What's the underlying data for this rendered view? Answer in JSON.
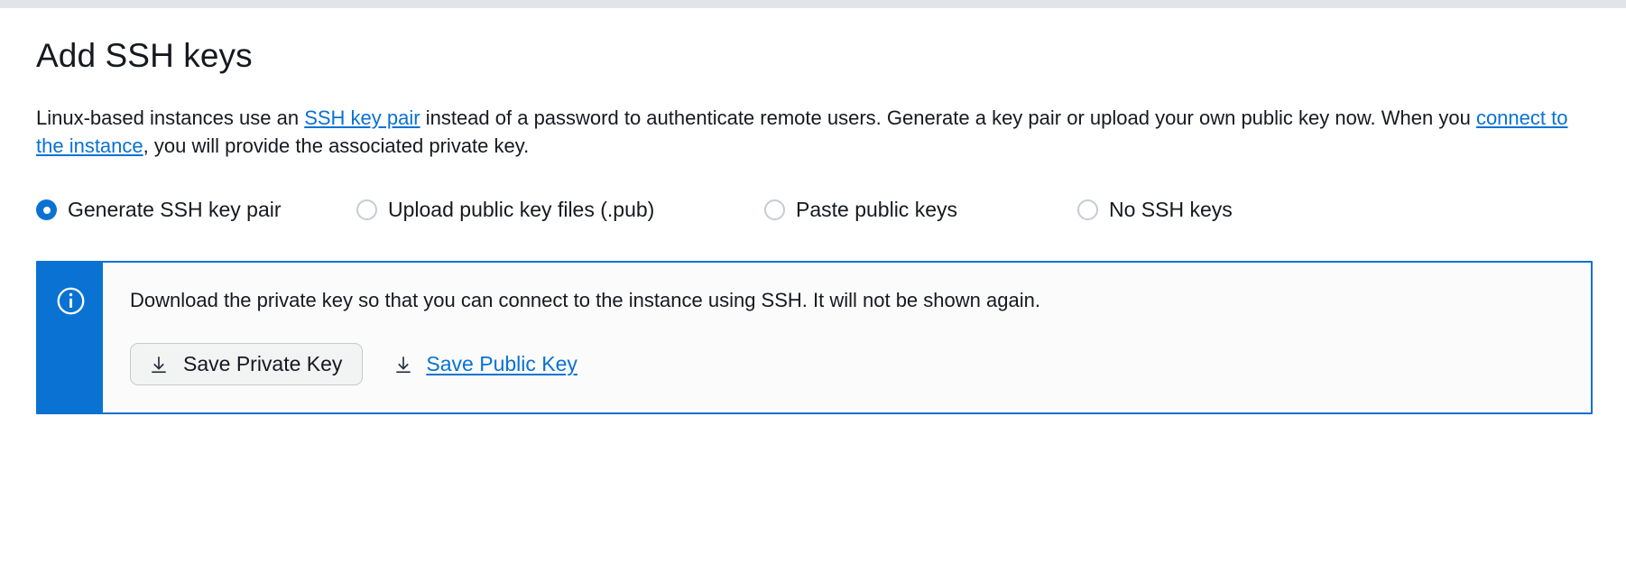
{
  "page": {
    "title": "Add SSH keys",
    "intro": {
      "part1": "Linux-based instances use an ",
      "link1": "SSH key pair",
      "part2": " instead of a password to authenticate remote users. Generate a key pair or upload your own public key now. When you ",
      "link2": "connect to the instance",
      "part3": ", you will provide the associated private key."
    }
  },
  "ssh_key_options": {
    "selected": "Generate SSH key pair",
    "items": [
      {
        "label": "Generate SSH key pair",
        "selected": true
      },
      {
        "label": "Upload public key files (.pub)",
        "selected": false
      },
      {
        "label": "Paste public keys",
        "selected": false
      },
      {
        "label": "No SSH keys",
        "selected": false
      }
    ]
  },
  "alert": {
    "type": "info",
    "icon": "info-circle-icon",
    "message": "Download the private key so that you can connect to the instance using SSH. It will not be shown again.",
    "save_private_key_label": "Save Private Key",
    "save_public_key_label": "Save Public Key",
    "download_icon": "download-arrow-icon"
  },
  "colors": {
    "accent_blue": "#0972d3",
    "link_blue": "#0972d3",
    "text": "#16191f",
    "alert_background": "#fbfbfb",
    "button_background": "#f2f3f3",
    "radio_off_border": "#c6cbd4",
    "top_strip": "#e1e4e8"
  }
}
